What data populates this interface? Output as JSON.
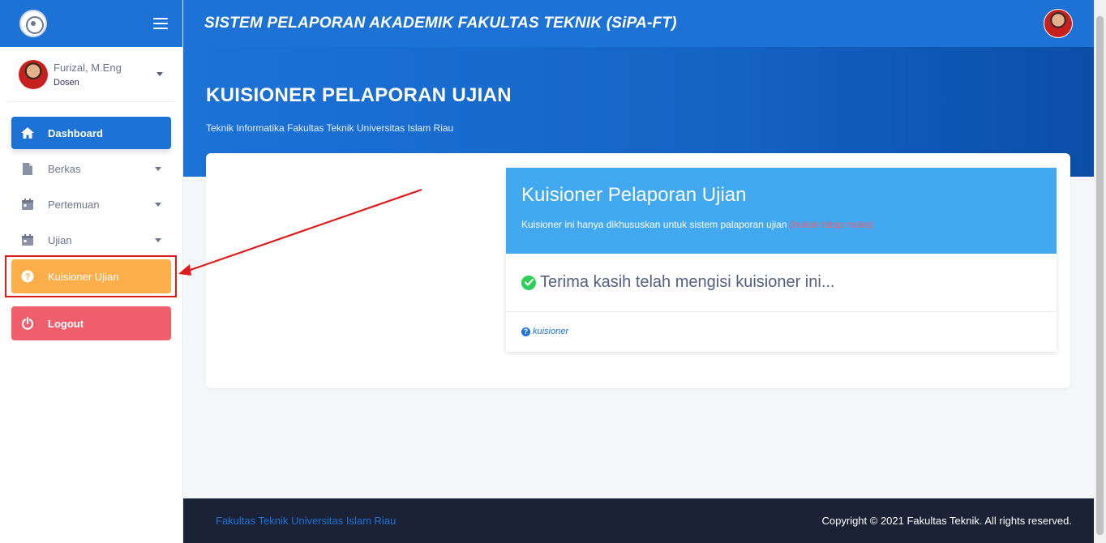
{
  "app": {
    "title": "SISTEM PELAPORAN AKADEMIK FAKULTAS TEKNIK (SiPA-FT)"
  },
  "user": {
    "name": "Furizal, M.Eng",
    "role": "Dosen"
  },
  "nav": {
    "items": [
      {
        "label": "Dashboard",
        "icon": "home-icon"
      },
      {
        "label": "Berkas",
        "icon": "file-icon"
      },
      {
        "label": "Pertemuan",
        "icon": "calendar-icon"
      },
      {
        "label": "Ujian",
        "icon": "calendar-icon"
      },
      {
        "label": "Kuisioner Ujian",
        "icon": "question-circle-icon"
      },
      {
        "label": "Logout",
        "icon": "power-icon"
      }
    ]
  },
  "hero": {
    "title": "KUISIONER PELAPORAN UJIAN",
    "subtitle": "Teknik Informatika Fakultas Teknik Universitas Islam Riau"
  },
  "questionnaire": {
    "title": "Kuisioner Pelaporan Ujian",
    "description": "Kuisioner ini hanya dikhususkan untuk sistem palaporan ujian",
    "note": "(bukan tatap muka)",
    "message": "Terima kasih telah mengisi kuisioner ini...",
    "link": "kuisioner"
  },
  "footer": {
    "left": "Fakultas Teknik Universitas Islam Riau",
    "right": "Copyright © 2021 Fakultas Teknik. All rights reserved."
  },
  "colors": {
    "primary": "#1d72d6",
    "warning": "#fcae4a",
    "danger": "#f25f6c",
    "info": "#42a9f1",
    "success": "#2dce5a",
    "annotation": "#e01b1b"
  }
}
